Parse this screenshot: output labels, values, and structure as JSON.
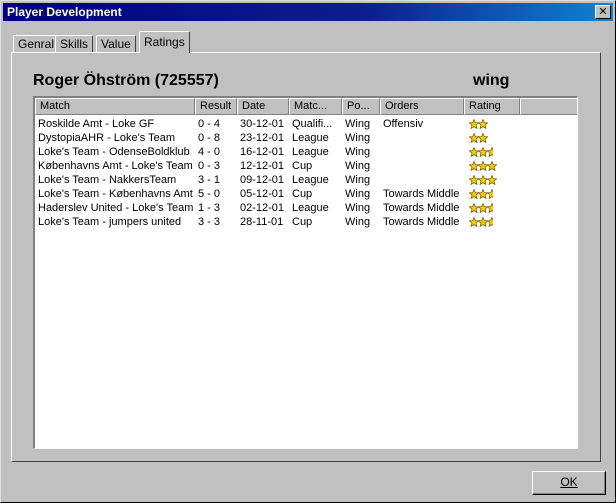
{
  "window": {
    "title": "Player Development",
    "close_glyph": "✕"
  },
  "tabs": [
    {
      "label": "Genral",
      "active": false
    },
    {
      "label": "Skills",
      "active": false
    },
    {
      "label": "Value",
      "active": false
    },
    {
      "label": "Ratings",
      "active": true
    }
  ],
  "player": {
    "name": "Roger Öhström (725557)",
    "position": "wing"
  },
  "table": {
    "columns": [
      "Match",
      "Result",
      "Date",
      "Matc...",
      "Po...",
      "Orders",
      "Rating"
    ],
    "rows": [
      {
        "match": "Roskilde Amt - Loke GF",
        "result": "0 - 4",
        "date": "30-12-01",
        "type": "Qualifi...",
        "pos": "Wing",
        "orders": "Offensiv",
        "rating": 2.0
      },
      {
        "match": "DystopiaAHR - Loke's Team",
        "result": "0 - 8",
        "date": "23-12-01",
        "type": "League",
        "pos": "Wing",
        "orders": "",
        "rating": 2.0
      },
      {
        "match": "Loke's Team - OdenseBoldklub",
        "result": "4 - 0",
        "date": "16-12-01",
        "type": "League",
        "pos": "Wing",
        "orders": "",
        "rating": 2.5
      },
      {
        "match": "Københavns Amt - Loke's Team",
        "result": "0 - 3",
        "date": "12-12-01",
        "type": "Cup",
        "pos": "Wing",
        "orders": "",
        "rating": 3.0
      },
      {
        "match": "Loke's Team - NakkersTeam",
        "result": "3 - 1",
        "date": "09-12-01",
        "type": "League",
        "pos": "Wing",
        "orders": "",
        "rating": 3.0
      },
      {
        "match": "Loke's Team - Københavns Amt",
        "result": "5 - 0",
        "date": "05-12-01",
        "type": "Cup",
        "pos": "Wing",
        "orders": "Towards Middle",
        "rating": 2.5
      },
      {
        "match": "Haderslev United - Loke's Team",
        "result": "1 - 3",
        "date": "02-12-01",
        "type": "League",
        "pos": "Wing",
        "orders": "Towards Middle",
        "rating": 2.5
      },
      {
        "match": "Loke's Team - jumpers united",
        "result": "3 - 3",
        "date": "28-11-01",
        "type": "Cup",
        "pos": "Wing",
        "orders": "Towards Middle",
        "rating": 2.5
      }
    ]
  },
  "buttons": {
    "ok_label": "OK"
  },
  "colors": {
    "titlebar": "#000080",
    "star_fill": "#f5d000",
    "star_outline": "#806000"
  },
  "icons": {
    "rating": "star-icon",
    "close": "close-icon"
  }
}
